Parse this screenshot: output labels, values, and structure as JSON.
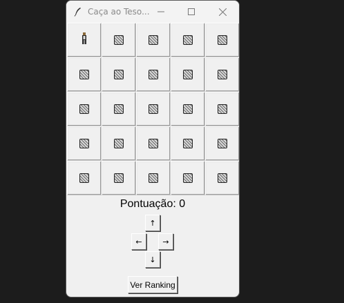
{
  "window": {
    "title": "Caça ao Teso...",
    "icon": "feather-icon",
    "controls": [
      "minimize-icon",
      "maximize-icon",
      "close-icon"
    ]
  },
  "board": {
    "rows": 5,
    "cols": 5,
    "player": {
      "row": 0,
      "col": 0,
      "icon": "player-figure-icon"
    },
    "hidden_tile_icon": "hatched-square-icon"
  },
  "score": {
    "text": "Pontuação: 0"
  },
  "controls": {
    "up": "↑",
    "left": "←",
    "right": "→",
    "down": "↓"
  },
  "ranking_button": {
    "label": "Ver Ranking"
  }
}
